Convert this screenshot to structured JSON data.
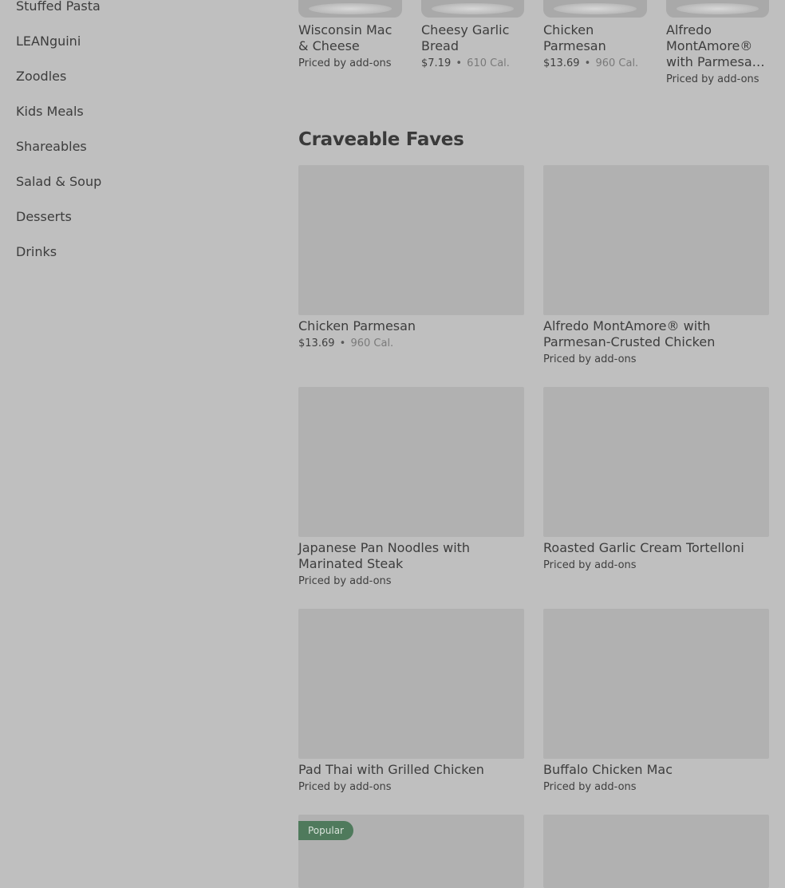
{
  "sidebar": {
    "items": [
      {
        "label": "Stuffed Pasta"
      },
      {
        "label": "LEANguini"
      },
      {
        "label": "Zoodles"
      },
      {
        "label": "Kids Meals"
      },
      {
        "label": "Shareables"
      },
      {
        "label": "Salad & Soup"
      },
      {
        "label": "Desserts"
      },
      {
        "label": "Drinks"
      }
    ]
  },
  "carousel": {
    "items": [
      {
        "name": "Wisconsin Mac & Cheese",
        "price_text": "Priced by add-ons"
      },
      {
        "name": "Cheesy Garlic Bread",
        "price": "$7.19",
        "sep": "•",
        "calories": "610 Cal."
      },
      {
        "name": "Chicken Parmesan",
        "price": "$13.69",
        "sep": "•",
        "calories": "960 Cal."
      },
      {
        "name": "Alfredo MontAmore® with Parmesan-Crusted Chicken",
        "price_text": "Priced by add-ons"
      }
    ]
  },
  "section": {
    "title": "Craveable Faves",
    "cards": [
      {
        "name": "Chicken Parmesan",
        "price": "$13.69",
        "sep": "•",
        "calories": "960 Cal."
      },
      {
        "name": "Alfredo MontAmore® with Parmesan-Crusted Chicken",
        "price_text": "Priced by add-ons"
      },
      {
        "name": "Japanese Pan Noodles with Marinated Steak",
        "price_text": "Priced by add-ons"
      },
      {
        "name": "Roasted Garlic Cream Tortelloni",
        "price_text": "Priced by add-ons"
      },
      {
        "name": "Pad Thai with Grilled Chicken",
        "price_text": "Priced by add-ons"
      },
      {
        "name": "Buffalo Chicken Mac",
        "price_text": "Priced by add-ons"
      },
      {
        "badge": "Popular"
      },
      {}
    ]
  },
  "colors": {
    "overlay_background": "#bfbfbf",
    "image_placeholder": "#b1b1b1",
    "badge_background": "#4f7a5c"
  }
}
